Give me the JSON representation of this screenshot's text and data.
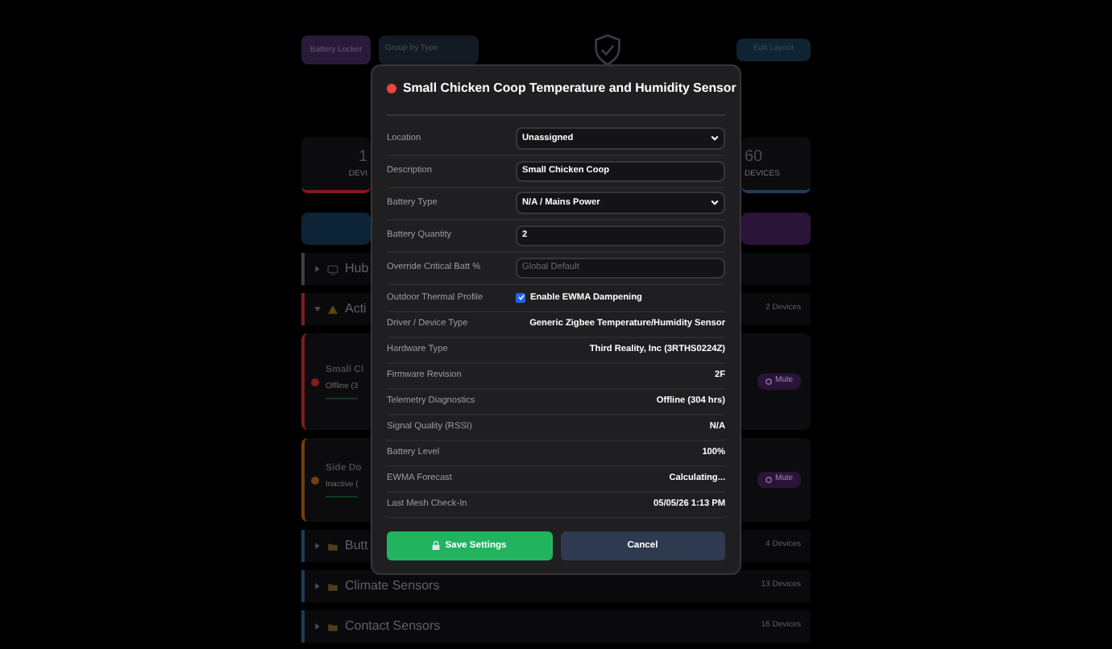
{
  "toolbar": {
    "battery_locker": "Battery Locker",
    "group_by": "Group by Type",
    "edit_layout": "Edit Layout"
  },
  "stats": [
    {
      "value": "1",
      "label": "DEVI",
      "color": "#7f1d1d"
    },
    {
      "value": "60",
      "label": "DEVICES",
      "color": "#1e3a5f"
    }
  ],
  "groups_before": [
    {
      "title": "Hub",
      "kind": "hub",
      "expanded": false,
      "color": "#3f3f46"
    },
    {
      "title": "Acti",
      "kind": "alert",
      "expanded": true,
      "count": "2 Devices",
      "color": "#7f1d1d"
    }
  ],
  "devices": [
    {
      "name": "Small Cl",
      "status": "Offline (3",
      "color": "#7f1d1d",
      "mute": "Mute"
    },
    {
      "name": "Side Do",
      "status": "Inactive (",
      "color": "#713f12",
      "mute": "Mute"
    }
  ],
  "groups_after": [
    {
      "title": "Butt",
      "kind": "category",
      "expanded": false,
      "count": "4 Devices",
      "color": "#1e3a5f"
    },
    {
      "title": "Climate Sensors",
      "kind": "category",
      "expanded": false,
      "count": "13 Devices",
      "color": "#1e3a5f"
    },
    {
      "title": "Contact Sensors",
      "kind": "category",
      "expanded": false,
      "count": "16 Devices",
      "color": "#1e3a5f"
    }
  ],
  "modal": {
    "title": "Small Chicken Coop Temperature and Humidity Sensor",
    "color": "#ef4444",
    "fields": [
      {
        "kind": "select",
        "label": "Location",
        "value": "Unassigned"
      },
      {
        "kind": "text",
        "label": "Description",
        "value": "Small Chicken Coop"
      },
      {
        "kind": "select",
        "label": "Battery Type",
        "value": "N/A / Mains Power"
      },
      {
        "kind": "text",
        "label": "Battery Quantity",
        "value": "2"
      },
      {
        "kind": "text",
        "label": "Override Critical Batt %",
        "placeholder": "Global Default"
      },
      {
        "kind": "checkbox",
        "label": "Outdoor Thermal Profile",
        "value": "Enable EWMA Dampening",
        "checked": true
      },
      {
        "kind": "info",
        "label": "Driver / Device Type",
        "value": "Generic Zigbee Temperature/Humidity Sensor"
      },
      {
        "kind": "info",
        "label": "Hardware Type",
        "value": "Third Reality, Inc (3RTHS0224Z)"
      },
      {
        "kind": "info",
        "label": "Firmware Revision",
        "value": "2F"
      },
      {
        "kind": "info",
        "label": "Telemetry Diagnostics",
        "value": "Offline (304 hrs)"
      },
      {
        "kind": "info",
        "label": "Signal Quality (RSSI)",
        "value": "N/A"
      },
      {
        "kind": "info",
        "label": "Battery Level",
        "value": "100%"
      },
      {
        "kind": "info",
        "label": "EWMA Forecast",
        "value": "Calculating..."
      },
      {
        "kind": "info",
        "label": "Last Mesh Check-In",
        "value": "05/05/26 1:13 PM"
      }
    ],
    "save": "Save Settings",
    "cancel": "Cancel"
  }
}
